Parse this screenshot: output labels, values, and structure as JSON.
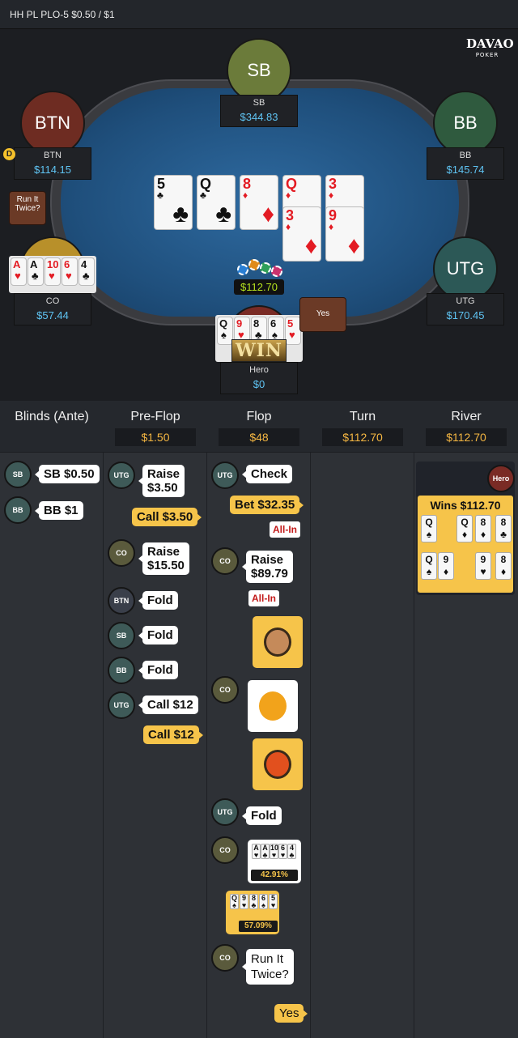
{
  "title": "HH PL PLO-5 $0.50 / $1",
  "logo": {
    "main": "DAVAO",
    "sub": "POKER"
  },
  "seats": {
    "sb": {
      "avatar": "SB",
      "name": "SB",
      "stack": "$344.83"
    },
    "btn": {
      "avatar": "BTN",
      "name": "BTN",
      "stack": "$114.15"
    },
    "bb": {
      "avatar": "BB",
      "name": "BB",
      "stack": "$145.74"
    },
    "co": {
      "name": "CO",
      "stack": "$57.44"
    },
    "utg": {
      "avatar": "UTG",
      "name": "UTG",
      "stack": "$170.45"
    },
    "hero": {
      "name": "Hero",
      "stack": "$0"
    }
  },
  "dealer_label": "D",
  "rit_bubble": "Run It Twice?",
  "yes_bubble": "Yes",
  "pot": "$112.70",
  "win_label": "WIN",
  "board_top": [
    {
      "r": "5",
      "s": "♣",
      "c": "black"
    },
    {
      "r": "Q",
      "s": "♣",
      "c": "black"
    },
    {
      "r": "8",
      "s": "♦",
      "c": "red"
    },
    {
      "r": "Q",
      "s": "♦",
      "c": "red"
    },
    {
      "r": "3",
      "s": "♦",
      "c": "red"
    }
  ],
  "board_bottom": [
    {
      "r": "3",
      "s": "♦",
      "c": "red"
    },
    {
      "r": "9",
      "s": "♦",
      "c": "red"
    }
  ],
  "co_cards": [
    {
      "r": "A",
      "s": "♥",
      "c": "red"
    },
    {
      "r": "A",
      "s": "♣",
      "c": "black"
    },
    {
      "r": "10",
      "s": "♥",
      "c": "red"
    },
    {
      "r": "6",
      "s": "♥",
      "c": "red"
    },
    {
      "r": "4",
      "s": "♣",
      "c": "black"
    }
  ],
  "hero_cards": [
    {
      "r": "Q",
      "s": "♠",
      "c": "black"
    },
    {
      "r": "9",
      "s": "♥",
      "c": "red"
    },
    {
      "r": "8",
      "s": "♣",
      "c": "black"
    },
    {
      "r": "6",
      "s": "♠",
      "c": "black"
    },
    {
      "r": "5",
      "s": "♥",
      "c": "red"
    }
  ],
  "columns": [
    {
      "name": "Blinds (Ante)",
      "pot": ""
    },
    {
      "name": "Pre-Flop",
      "pot": "$1.50"
    },
    {
      "name": "Flop",
      "pot": "$48"
    },
    {
      "name": "Turn",
      "pot": "$112.70"
    },
    {
      "name": "River",
      "pot": "$112.70"
    }
  ],
  "blinds": [
    {
      "pos": "SB",
      "text": "SB $0.50"
    },
    {
      "pos": "BB",
      "text": "BB $1"
    }
  ],
  "preflop": [
    {
      "pos": "UTG",
      "text": "Raise\n$3.50"
    },
    {
      "hero": true,
      "text": "Call $3.50"
    },
    {
      "pos": "CO",
      "text": "Raise\n$15.50"
    },
    {
      "pos": "BTN",
      "text": "Fold"
    },
    {
      "pos": "SB",
      "text": "Fold"
    },
    {
      "pos": "BB",
      "text": "Fold"
    },
    {
      "pos": "UTG",
      "text": "Call $12"
    },
    {
      "hero": true,
      "text": "Call $12"
    }
  ],
  "flop": {
    "utg_check": "Check",
    "hero_bet": "Bet $32.35",
    "allin1": "All-In",
    "co_raise": "Raise\n$89.79",
    "allin2": "All-In",
    "utg_fold": "Fold",
    "co_equity": "42.91%",
    "hero_equity": "57.09%",
    "co_rit": "Run It\nTwice?",
    "hero_yes": "Yes",
    "co_eq_cards": [
      {
        "r": "A",
        "s": "♥",
        "c": "red"
      },
      {
        "r": "A",
        "s": "♣",
        "c": "black"
      },
      {
        "r": "10",
        "s": "♥",
        "c": "red"
      },
      {
        "r": "6",
        "s": "♥",
        "c": "red"
      },
      {
        "r": "4",
        "s": "♣",
        "c": "black"
      }
    ],
    "hero_eq_cards": [
      {
        "r": "Q",
        "s": "♠",
        "c": "black"
      },
      {
        "r": "9",
        "s": "♥",
        "c": "red"
      },
      {
        "r": "8",
        "s": "♣",
        "c": "black"
      },
      {
        "r": "6",
        "s": "♠",
        "c": "black"
      },
      {
        "r": "5",
        "s": "♥",
        "c": "red"
      }
    ]
  },
  "river": {
    "hero_badge": "Hero",
    "wins": "Wins $112.70",
    "row1": [
      {
        "r": "Q",
        "s": "♠",
        "c": "black"
      },
      {
        "r": "Q",
        "s": "♦",
        "c": "red"
      },
      {
        "r": "8",
        "s": "♦",
        "c": "red"
      },
      {
        "r": "8",
        "s": "♣",
        "c": "black"
      }
    ],
    "row2": [
      {
        "r": "Q",
        "s": "♠",
        "c": "black"
      },
      {
        "r": "9",
        "s": "♦",
        "c": "red"
      },
      {
        "r": "9",
        "s": "♥",
        "c": "red"
      },
      {
        "r": "8",
        "s": "♦",
        "c": "red"
      }
    ]
  }
}
